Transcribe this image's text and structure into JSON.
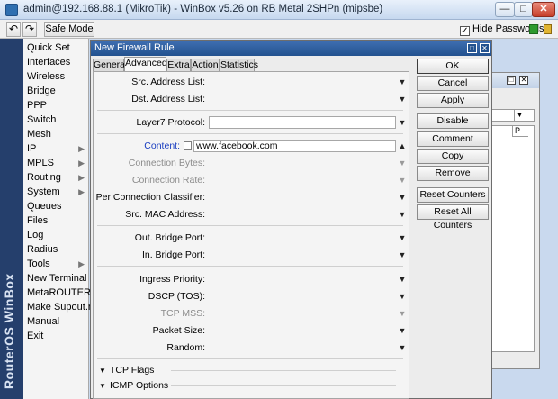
{
  "window": {
    "title": "admin@192.168.88.1 (MikroTik) - WinBox v5.26 on RB Metal 2SHPn (mipsbe)",
    "min": "—",
    "max": "□",
    "close": "✕"
  },
  "toolbar": {
    "undo": "↶",
    "redo": "↷",
    "safe_mode": "Safe Mode",
    "hide_passwords": "Hide Passwords",
    "hide_passwords_checked": "✓"
  },
  "brand": "RouterOS WinBox",
  "sidebar": [
    {
      "label": "Quick Set",
      "arrow": ""
    },
    {
      "label": "Interfaces",
      "arrow": ""
    },
    {
      "label": "Wireless",
      "arrow": ""
    },
    {
      "label": "Bridge",
      "arrow": ""
    },
    {
      "label": "PPP",
      "arrow": ""
    },
    {
      "label": "Switch",
      "arrow": ""
    },
    {
      "label": "Mesh",
      "arrow": ""
    },
    {
      "label": "IP",
      "arrow": "▶"
    },
    {
      "label": "MPLS",
      "arrow": "▶"
    },
    {
      "label": "Routing",
      "arrow": "▶"
    },
    {
      "label": "System",
      "arrow": "▶"
    },
    {
      "label": "Queues",
      "arrow": ""
    },
    {
      "label": "Files",
      "arrow": ""
    },
    {
      "label": "Log",
      "arrow": ""
    },
    {
      "label": "Radius",
      "arrow": ""
    },
    {
      "label": "Tools",
      "arrow": "▶"
    },
    {
      "label": "New Terminal",
      "arrow": ""
    },
    {
      "label": "MetaROUTER",
      "arrow": ""
    },
    {
      "label": "Make Supout.rif",
      "arrow": ""
    },
    {
      "label": "Manual",
      "arrow": ""
    },
    {
      "label": "Exit",
      "arrow": ""
    }
  ],
  "dialog": {
    "title": "New Firewall Rule",
    "tabs": [
      "General",
      "Advanced",
      "Extra",
      "Action",
      "Statistics"
    ],
    "active_tab": "Advanced",
    "fields": [
      {
        "label": "Src. Address List:"
      },
      {
        "label": "Dst. Address List:"
      },
      {
        "label": "Layer7 Protocol:"
      },
      {
        "label": "Content:",
        "value": "www.facebook.com"
      },
      {
        "label": "Connection Bytes:"
      },
      {
        "label": "Connection Rate:"
      },
      {
        "label": "Per Connection Classifier:"
      },
      {
        "label": "Src. MAC Address:"
      },
      {
        "label": "Out. Bridge Port:"
      },
      {
        "label": "In. Bridge Port:"
      },
      {
        "label": "Ingress Priority:"
      },
      {
        "label": "DSCP (TOS):"
      },
      {
        "label": "TCP MSS:"
      },
      {
        "label": "Packet Size:"
      },
      {
        "label": "Random:"
      }
    ],
    "sections": [
      "TCP Flags",
      "ICMP Options"
    ],
    "buttons": [
      "OK",
      "Cancel",
      "Apply",
      "Disable",
      "Comment",
      "Copy",
      "Remove",
      "Reset Counters",
      "Reset All Counters"
    ]
  },
  "background_window": {
    "column": "P"
  }
}
